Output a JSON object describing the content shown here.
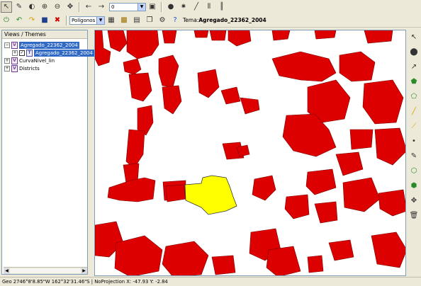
{
  "toolbar": {
    "scale_value": "0",
    "symbol_combo": "Polígonos",
    "theme_prefix": "Tema:",
    "theme_name": "Agregado_22362_2004"
  },
  "views_panel": {
    "title": "Views / Themes",
    "tree": [
      {
        "label": "Agregado_22362_2004",
        "level": 0,
        "selected": true
      },
      {
        "label": "Agregado_22362_2004",
        "level": 1,
        "selected": true
      },
      {
        "label": "CurvaNivel_lin",
        "level": 0,
        "selected": false
      },
      {
        "label": "Districts",
        "level": 0,
        "selected": false
      }
    ]
  },
  "status": {
    "coords": "Geo 2746°8'8.85\"W 162°32'31.46\"S",
    "projection": "NoProjection",
    "xy": "X: -47.93 Y: -2.84"
  },
  "colors": {
    "polygon_fill": "#dd0000",
    "selected_fill": "#ffff00",
    "selection_blue": "#316ac5",
    "map_bg": "#ffffff"
  }
}
